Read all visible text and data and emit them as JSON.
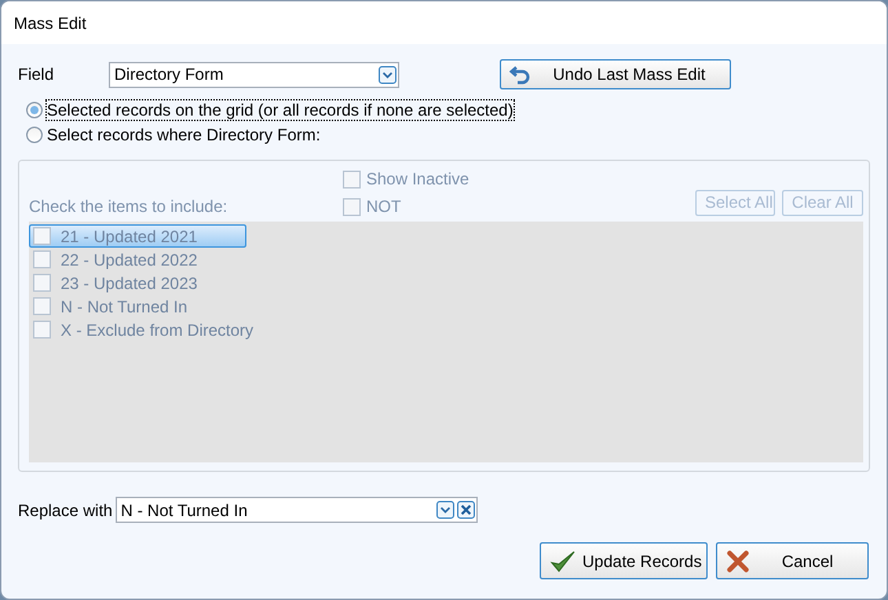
{
  "window": {
    "title": "Mass Edit"
  },
  "field": {
    "label": "Field",
    "value": "Directory Form"
  },
  "undo_button": {
    "label": "Undo Last Mass Edit"
  },
  "scope": [
    {
      "label": "Selected records on the grid (or all records if none are selected)",
      "selected": true
    },
    {
      "label": "Select records where Directory Form:",
      "selected": false
    }
  ],
  "filter": {
    "disabled": true,
    "show_inactive": {
      "label": "Show Inactive",
      "checked": false
    },
    "not": {
      "label": "NOT",
      "checked": false
    },
    "instructions": "Check the items to include:",
    "buttons": [
      "Select All",
      "Clear All"
    ],
    "items": [
      {
        "label": "21 - Updated 2021",
        "checked": false,
        "selected": true
      },
      {
        "label": "22 - Updated 2022",
        "checked": false,
        "selected": false
      },
      {
        "label": "23 - Updated 2023",
        "checked": false,
        "selected": false
      },
      {
        "label": "N - Not Turned In",
        "checked": false,
        "selected": false
      },
      {
        "label": "X - Exclude from Directory",
        "checked": false,
        "selected": false
      }
    ]
  },
  "replace": {
    "label": "Replace with",
    "value": "N - Not Turned In"
  },
  "buttons": [
    {
      "kind": "update",
      "label": "Update Records"
    },
    {
      "kind": "cancel",
      "label": "Cancel"
    }
  ]
}
